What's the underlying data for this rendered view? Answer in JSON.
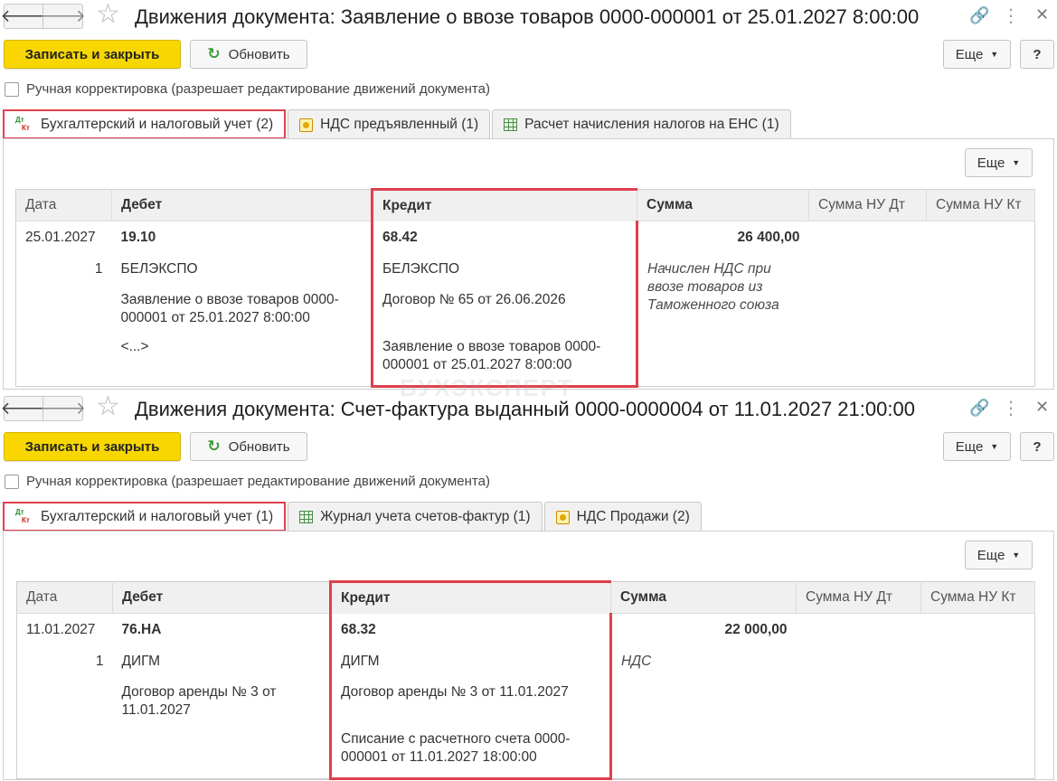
{
  "window1": {
    "title": "Движения документа: Заявление о ввозе товаров 0000-000001 от 25.01.2027 8:00:00",
    "save_close": "Записать и закрыть",
    "refresh": "Обновить",
    "more": "Еще",
    "help": "?",
    "manual_correction": "Ручная корректировка (разрешает редактирование движений документа)",
    "tabs": [
      {
        "label": "Бухгалтерский и налоговый учет (2)",
        "icon": "dt-kt-icon",
        "active": true
      },
      {
        "label": "НДС предъявленный (1)",
        "icon": "register-icon",
        "active": false
      },
      {
        "label": "Расчет начисления налогов на ЕНС (1)",
        "icon": "table-grid-icon",
        "active": false
      }
    ],
    "grid_more": "Еще",
    "columns": [
      "Дата",
      "Дебет",
      "Кредит",
      "Сумма",
      "Сумма НУ Дт",
      "Сумма НУ Кт"
    ],
    "row": {
      "date": "25.01.2027",
      "line_no": "1",
      "debit": [
        "19.10",
        "БЕЛЭКСПО",
        "Заявление о ввозе товаров 0000-000001 от 25.01.2027 8:00:00",
        "<...>"
      ],
      "credit": [
        "68.42",
        "БЕЛЭКСПО",
        "Договор № 65 от 26.06.2026",
        "Заявление о ввозе товаров 0000-000001 от 25.01.2027 8:00:00"
      ],
      "amount": "26 400,00",
      "content": "Начислен НДС при ввозе товаров из Таможенного союза"
    }
  },
  "window2": {
    "title": "Движения документа: Счет-фактура выданный 0000-0000004 от 11.01.2027 21:00:00",
    "save_close": "Записать и закрыть",
    "refresh": "Обновить",
    "more": "Еще",
    "help": "?",
    "manual_correction": "Ручная корректировка (разрешает редактирование движений документа)",
    "tabs": [
      {
        "label": "Бухгалтерский и налоговый учет (1)",
        "icon": "dt-kt-icon",
        "active": true
      },
      {
        "label": "Журнал учета счетов-фактур (1)",
        "icon": "table-grid-icon",
        "active": false
      },
      {
        "label": "НДС Продажи (2)",
        "icon": "register-icon",
        "active": false
      }
    ],
    "grid_more": "Еще",
    "columns": [
      "Дата",
      "Дебет",
      "Кредит",
      "Сумма",
      "Сумма НУ Дт",
      "Сумма НУ Кт"
    ],
    "row": {
      "date": "11.01.2027",
      "line_no": "1",
      "debit": [
        "76.НА",
        "ДИГМ",
        "Договор аренды № 3 от 11.01.2027"
      ],
      "credit": [
        "68.32",
        "ДИГМ",
        "Договор аренды № 3 от 11.01.2027",
        "Списание с расчетного счета 0000-000001 от 11.01.2027 18:00:00"
      ],
      "amount": "22 000,00",
      "content": "НДС"
    }
  },
  "watermark": "БУХЭКСПЕРТ",
  "colors": {
    "accent_yellow": "#f8d700",
    "highlight_red": "#e0404c",
    "refresh_green": "#3a9d3a"
  }
}
